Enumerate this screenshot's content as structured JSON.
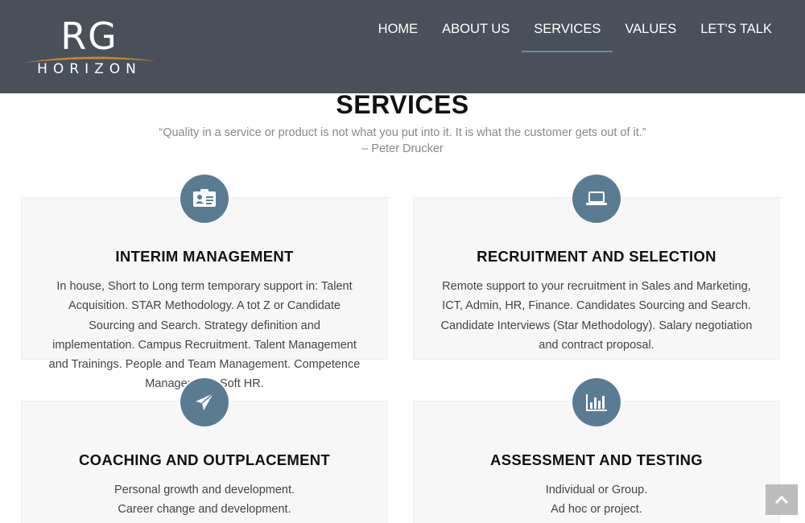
{
  "logo": {
    "line1": "RG",
    "line2": "HORIZON"
  },
  "nav": {
    "items": [
      {
        "label": "HOME"
      },
      {
        "label": "ABOUT US"
      },
      {
        "label": "SERVICES",
        "active": true
      },
      {
        "label": "VALUES"
      },
      {
        "label": "LET'S TALK"
      }
    ]
  },
  "services": {
    "title": "SERVICES",
    "quote": "“Quality in a service or product is not what you put into it. It is what the customer gets out of it.”",
    "quote_author": "– Peter Drucker",
    "cards": [
      {
        "icon": "id-card-icon",
        "title": "INTERIM MANAGEMENT",
        "text": "In house, Short to Long term temporary support in: Talent Acquisition. STAR Methodology. A tot Z or Candidate Sourcing and Search. Strategy definition and implementation. Campus Recruitment. Talent Management and Trainings. People and Team Management. Competence Management. Soft HR."
      },
      {
        "icon": "laptop-icon",
        "title": "RECRUITMENT AND SELECTION",
        "text": "Remote support to your recruitment in Sales and Marketing, ICT, Admin, HR, Finance. Candidates Sourcing and Search. Candidate Interviews (Star Methodology). Salary negotiation and contract proposal."
      },
      {
        "icon": "paper-plane-icon",
        "title": "COACHING AND OUTPLACEMENT",
        "lines": [
          "Personal growth and development.",
          "Career change and development."
        ]
      },
      {
        "icon": "bar-chart-icon",
        "title": "ASSESSMENT AND TESTING",
        "lines": [
          "Individual or Group.",
          "Ad hoc or project."
        ]
      }
    ]
  },
  "colors": {
    "header_bg": "#4a5059",
    "accent": "#5a7c93",
    "card_bg": "#f7f7f7",
    "active_underline": "#6a8ea6",
    "logo_swoosh": "#c8862e"
  }
}
